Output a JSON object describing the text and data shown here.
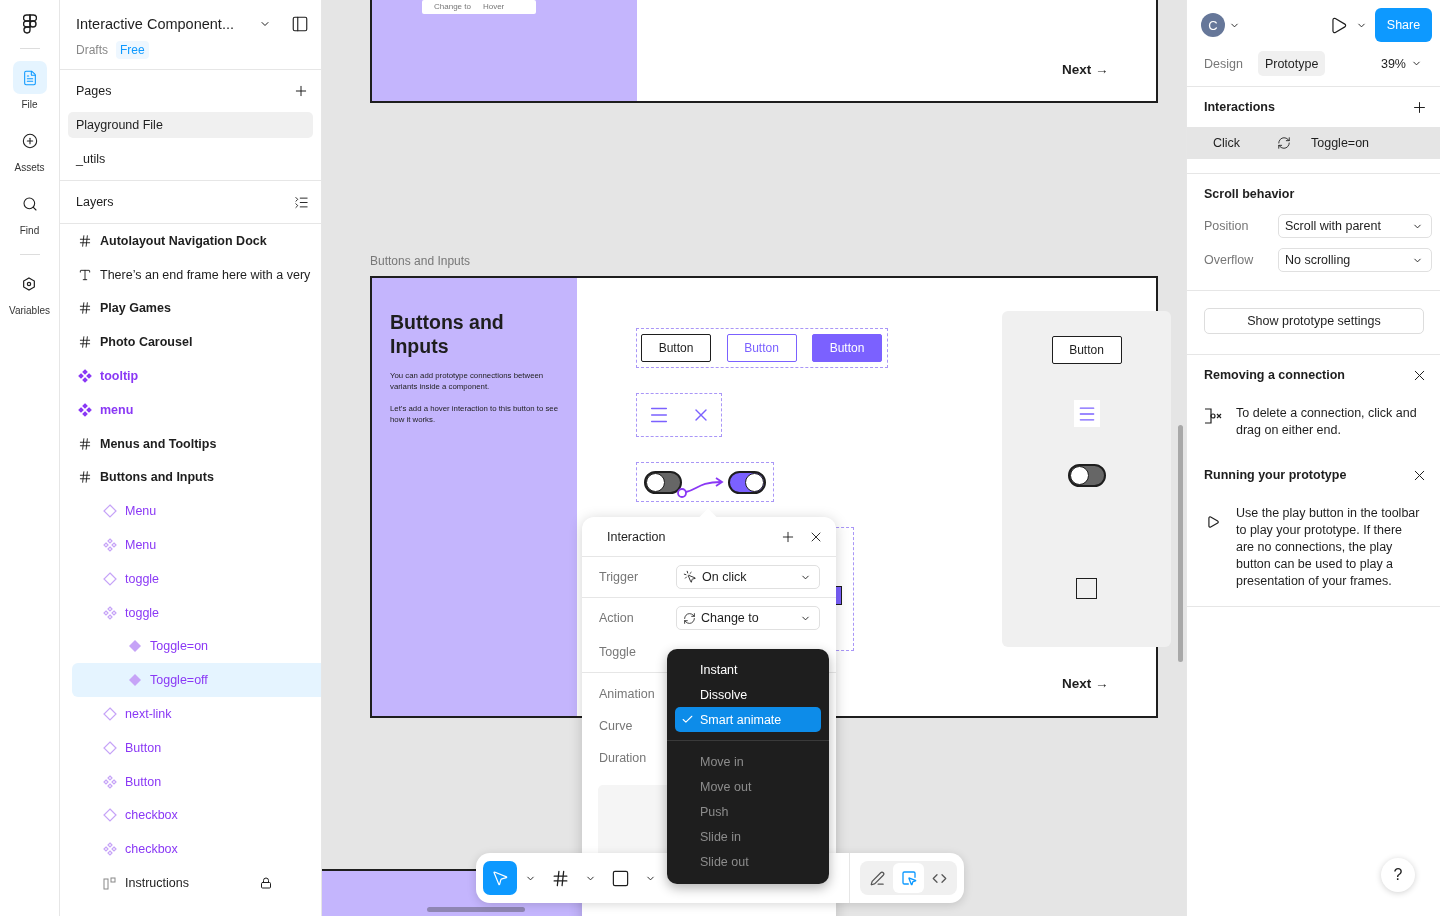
{
  "rail": [
    {
      "label": "File",
      "selected": true
    },
    {
      "label": "Assets",
      "selected": false
    },
    {
      "label": "Find",
      "selected": false
    },
    {
      "label": "Variables",
      "selected": false
    }
  ],
  "file": {
    "title": "Interactive Component...",
    "location": "Drafts",
    "plan": "Free"
  },
  "pages": {
    "title": "Pages",
    "items": [
      {
        "label": "Playground File",
        "selected": true
      },
      {
        "label": "_utils",
        "selected": false
      }
    ]
  },
  "layers": {
    "title": "Layers",
    "items": [
      {
        "kind": "frame",
        "label": "Autolayout Navigation Dock",
        "selected": false
      },
      {
        "kind": "text",
        "label": "There’s an end frame here with a very",
        "selected": false
      },
      {
        "kind": "frame",
        "label": "Play Games",
        "selected": false
      },
      {
        "kind": "frame",
        "label": "Photo Carousel",
        "selected": false
      },
      {
        "kind": "component",
        "label": "tooltip",
        "selected": false
      },
      {
        "kind": "component",
        "label": "menu",
        "selected": false
      },
      {
        "kind": "frame",
        "label": "Menus and Tooltips",
        "selected": false
      },
      {
        "kind": "frame",
        "label": "Buttons and Inputs",
        "selected": false,
        "children": [
          {
            "kind": "instance",
            "label": "Menu",
            "selected": false
          },
          {
            "kind": "set",
            "label": "Menu",
            "selected": false
          },
          {
            "kind": "instance",
            "label": "toggle",
            "selected": false
          },
          {
            "kind": "set",
            "label": "toggle",
            "selected": false,
            "children": [
              {
                "kind": "variant",
                "label": "Toggle=on",
                "selected": false
              },
              {
                "kind": "variant",
                "label": "Toggle=off",
                "selected": true
              }
            ]
          },
          {
            "kind": "instance",
            "label": "next-link",
            "selected": false
          },
          {
            "kind": "instance",
            "label": "Button",
            "selected": false
          },
          {
            "kind": "set",
            "label": "Button",
            "selected": false
          },
          {
            "kind": "instance",
            "label": "checkbox",
            "selected": false
          },
          {
            "kind": "set",
            "label": "checkbox",
            "selected": false
          },
          {
            "kind": "group",
            "label": "Instructions",
            "selected": false,
            "locked": true
          }
        ]
      }
    ]
  },
  "canvas": {
    "top_frame": {
      "mini": [
        "Change to",
        "Hover"
      ],
      "next": "Next →"
    },
    "frame_label": "Buttons and Inputs",
    "frame": {
      "title": "Buttons and Inputs",
      "paragraphs": [
        "You can add prototype connections between variants inside a component.",
        "Let’s add a hover interaction to this button to see how it works."
      ],
      "buttons": [
        {
          "label": "Button",
          "kind": "outline"
        },
        {
          "label": "Button",
          "kind": "accent"
        },
        {
          "label": "Button",
          "kind": "filled"
        }
      ],
      "toggles": [
        {
          "on": false
        },
        {
          "on": true
        }
      ],
      "partial_checkbox": {
        "checked": true
      },
      "preview": {
        "button": "Button",
        "toggle_on": false,
        "checked": false
      },
      "next": "Next →"
    }
  },
  "interaction": {
    "title": "Interaction",
    "fields": [
      {
        "label": "Trigger",
        "value": "On click",
        "kind": "click"
      },
      {
        "label": "Action",
        "value": "Change to",
        "kind": "swap"
      }
    ],
    "target_label": "Toggle",
    "labels": [
      "Animation",
      "Curve",
      "Duration"
    ]
  },
  "animation_menu": [
    {
      "label": "Instant",
      "selected": false,
      "disabled": false
    },
    {
      "label": "Dissolve",
      "selected": false,
      "disabled": false
    },
    {
      "label": "Smart animate",
      "selected": true,
      "disabled": false
    },
    {
      "label": "Move in",
      "selected": false,
      "disabled": true
    },
    {
      "label": "Move out",
      "selected": false,
      "disabled": true
    },
    {
      "label": "Push",
      "selected": false,
      "disabled": true
    },
    {
      "label": "Slide in",
      "selected": false,
      "disabled": true
    },
    {
      "label": "Slide out",
      "selected": false,
      "disabled": true
    }
  ],
  "toolbar": {
    "tools": [
      {
        "kind": "move",
        "selected": true
      },
      {
        "kind": "frame",
        "selected": false
      },
      {
        "kind": "shape",
        "selected": false
      }
    ],
    "modes": [
      {
        "kind": "draw",
        "selected": false
      },
      {
        "kind": "design",
        "selected": true
      },
      {
        "kind": "dev",
        "selected": false
      }
    ]
  },
  "right": {
    "avatar": "C",
    "share": "Share",
    "tabs": [
      {
        "label": "Design",
        "selected": false
      },
      {
        "label": "Prototype",
        "selected": true
      }
    ],
    "zoom": "39%",
    "interactions": {
      "title": "Interactions",
      "rows": [
        {
          "trigger": "Click",
          "target": "Toggle=on"
        }
      ]
    },
    "scroll": {
      "title": "Scroll behavior",
      "fields": [
        {
          "label": "Position",
          "value": "Scroll with parent"
        },
        {
          "label": "Overflow",
          "value": "No scrolling"
        }
      ]
    },
    "settings_button": "Show prototype settings",
    "tips": [
      {
        "kind": "disconnect",
        "title": "Removing a connection",
        "text": "To delete a connection, click and drag on either end."
      },
      {
        "kind": "play",
        "title": "Running your prototype",
        "text": "Use the play button in the toolbar to play your prototype. If there are no connections, the play button can be used to play a presentation of your frames."
      }
    ]
  },
  "help": "?"
}
